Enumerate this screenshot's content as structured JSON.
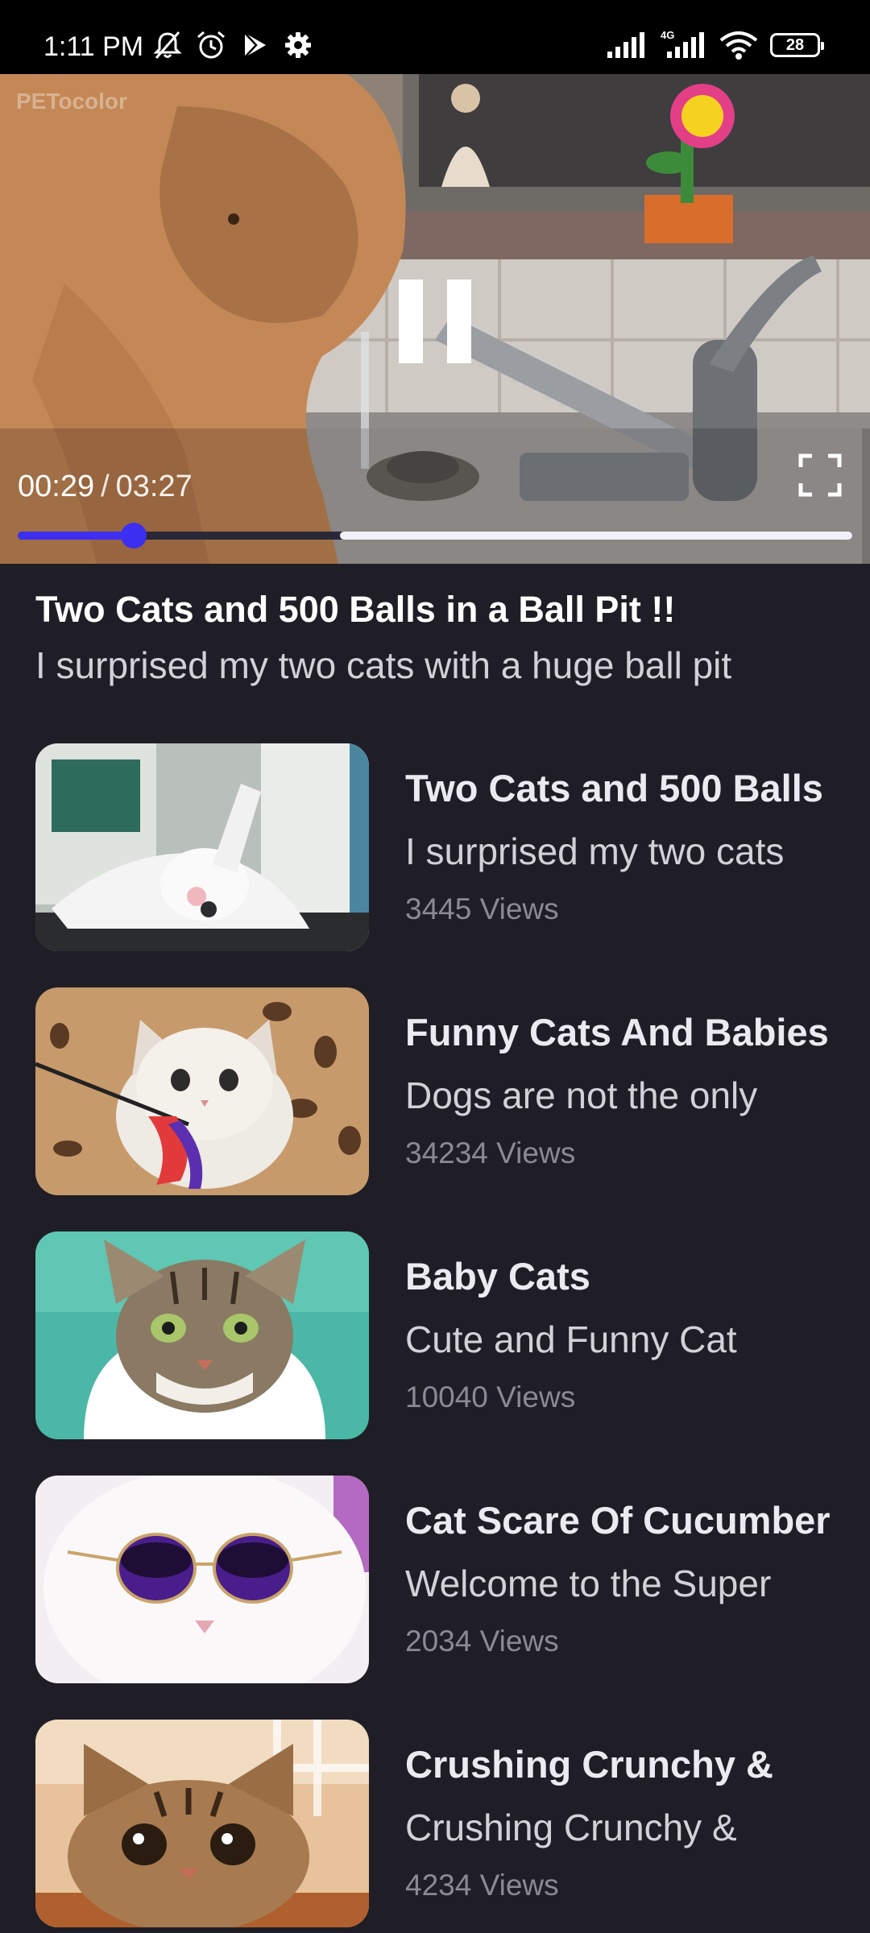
{
  "status_bar": {
    "time": "1:11 PM",
    "network_label": "4G",
    "battery": "28",
    "left_icons": [
      "muted-bell-icon",
      "alarm-icon",
      "play-store-icon",
      "settings-gear-icon"
    ],
    "right_icons": [
      "signal-icon",
      "signal-4g-icon",
      "wifi-icon",
      "battery-icon"
    ]
  },
  "player": {
    "watermark": "PETocolor",
    "current_time": "00:29",
    "separator": "/",
    "total_time": "03:27",
    "played_fraction": 0.139,
    "buffered_fraction": 1.0,
    "accent_color": "#3d2ff0",
    "state": "playing"
  },
  "current_video": {
    "title": "Two Cats and 500 Balls in a Ball Pit !!",
    "description": "I surprised my two cats with a huge ball pit"
  },
  "related": [
    {
      "title": "Two Cats and 500 Balls",
      "description": "I surprised my two cats",
      "views": "3445 Views"
    },
    {
      "title": "Funny Cats And Babies",
      "description": "Dogs are not the only",
      "views": "34234 Views"
    },
    {
      "title": "Baby Cats",
      "description": "Cute and Funny Cat",
      "views": "10040 Views"
    },
    {
      "title": "Cat Scare Of Cucumber",
      "description": "Welcome to the Super",
      "views": "2034 Views"
    },
    {
      "title": "Crushing Crunchy &",
      "description": "Crushing Crunchy &",
      "views": "4234 Views"
    }
  ],
  "colors": {
    "background": "#1f1e26",
    "status_bar": "#000000",
    "title_text": "#ffffff",
    "secondary_text": "#d2d1d8",
    "views_text": "#8a8996"
  }
}
